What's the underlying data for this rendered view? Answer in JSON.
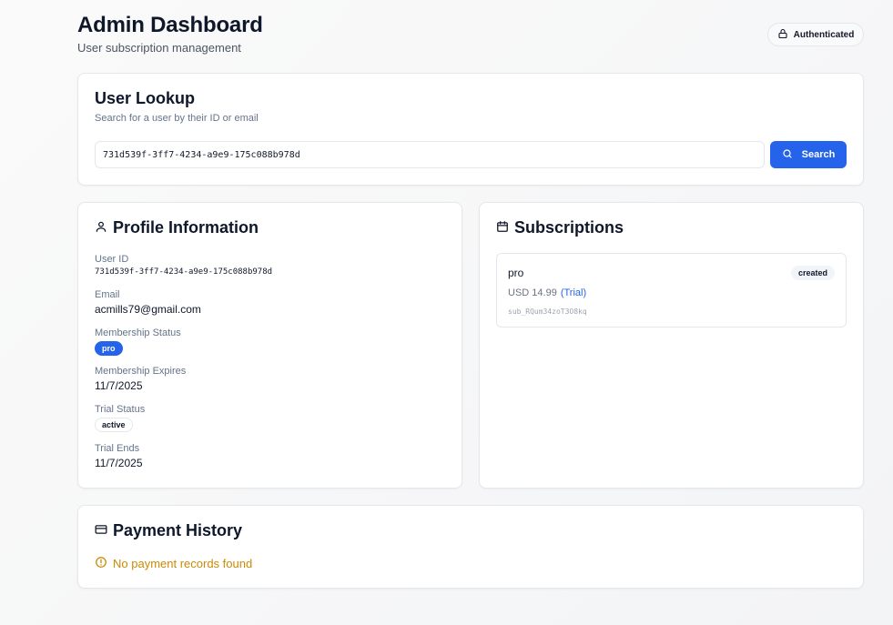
{
  "header": {
    "title": "Admin Dashboard",
    "subtitle": "User subscription management",
    "auth_badge": "Authenticated",
    "auth_icon": "lock-icon"
  },
  "lookup": {
    "title": "User Lookup",
    "description": "Search for a user by their ID or email",
    "input_value": "731d539f-3ff7-4234-a9e9-175c088b978d",
    "button_label": "Search",
    "button_icon": "search-icon",
    "accent": "#2563eb"
  },
  "profile": {
    "title": "Profile Information",
    "icon": "user-icon",
    "user_id_label": "User ID",
    "user_id": "731d539f-3ff7-4234-a9e9-175c088b978d",
    "email_label": "Email",
    "email": "acmills79@gmail.com",
    "membership_status_label": "Membership Status",
    "membership_status": "pro",
    "membership_expires_label": "Membership Expires",
    "membership_expires": "11/7/2025",
    "trial_status_label": "Trial Status",
    "trial_status": "active",
    "trial_ends_label": "Trial Ends",
    "trial_ends": "11/7/2025"
  },
  "subscriptions": {
    "title": "Subscriptions",
    "icon": "calendar-icon",
    "items": [
      {
        "plan": "pro",
        "status": "created",
        "price": "USD 14.99",
        "trial": "(Trial)",
        "id": "sub_RQum34zoT3O8kq"
      }
    ]
  },
  "payments": {
    "title": "Payment History",
    "icon": "credit-card-icon",
    "empty_message": "No payment records found",
    "warning_color": "#ca8a04"
  }
}
